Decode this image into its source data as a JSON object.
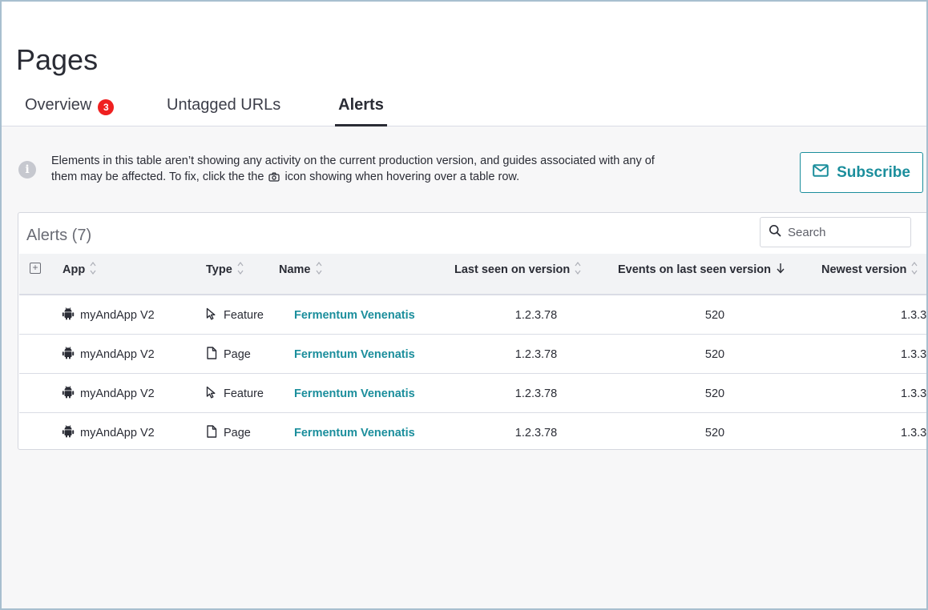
{
  "page": {
    "title": "Pages"
  },
  "tabs": [
    {
      "label": "Overview",
      "badge": "3",
      "active": false
    },
    {
      "label": "Untagged URLs",
      "active": false
    },
    {
      "label": "Alerts",
      "active": true
    }
  ],
  "banner": {
    "text_before": "Elements in this table aren’t showing any activity on the current production version, and guides associated with any of them may be affected. To fix, click the the",
    "text_after": "icon showing when hovering over a table row.",
    "icon": "info-icon",
    "inline_icon": "camera-icon"
  },
  "subscribe": {
    "label": "Subscribe",
    "icon": "mail-icon"
  },
  "table": {
    "title": "Alerts (7)",
    "search_placeholder": "Search",
    "columns": [
      {
        "label": "App",
        "sort": "unsorted"
      },
      {
        "label": "Type",
        "sort": "unsorted"
      },
      {
        "label": "Name",
        "sort": "unsorted"
      },
      {
        "label": "Last seen on version",
        "sort": "unsorted"
      },
      {
        "label": "Events on last seen version",
        "sort": "descending"
      },
      {
        "label": "Newest version",
        "sort": "unsorted"
      }
    ],
    "rows": [
      {
        "app": "myAndApp V2",
        "type": "Feature",
        "type_icon": "cursor-icon",
        "name": "Fermentum Venenatis",
        "last_seen": "1.2.3.78",
        "events": "520",
        "newest": "1.3.3"
      },
      {
        "app": "myAndApp V2",
        "type": "Page",
        "type_icon": "page-icon",
        "name": "Fermentum Venenatis",
        "last_seen": "1.2.3.78",
        "events": "520",
        "newest": "1.3.3"
      },
      {
        "app": "myAndApp V2",
        "type": "Feature",
        "type_icon": "cursor-icon",
        "name": "Fermentum Venenatis",
        "last_seen": "1.2.3.78",
        "events": "520",
        "newest": "1.3.3"
      },
      {
        "app": "myAndApp V2",
        "type": "Page",
        "type_icon": "page-icon",
        "name": "Fermentum Venenatis",
        "last_seen": "1.2.3.78",
        "events": "520",
        "newest": "1.3.3"
      }
    ]
  },
  "colors": {
    "accent": "#1b8e9c",
    "badge": "#ef2020",
    "text": "#2a2c35"
  }
}
